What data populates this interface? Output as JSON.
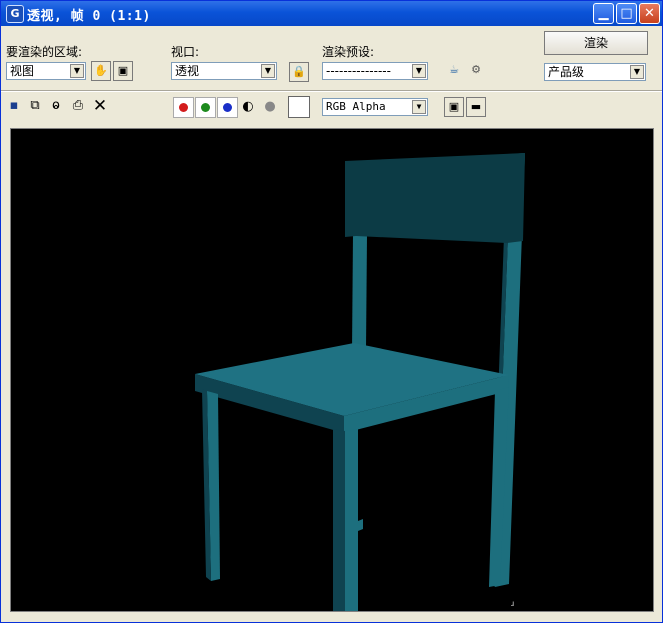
{
  "window": {
    "title": "透视, 帧 0 (1:1)",
    "app_icon": "G"
  },
  "controls": {
    "area_label": "要渲染的区域:",
    "area_value": "视图",
    "viewport_label": "视口:",
    "viewport_value": "透视",
    "preset_label": "渲染预设:",
    "preset_value": "---------------",
    "render_button": "渲染",
    "quality_value": "产品级"
  },
  "toolbar": {
    "channel_value": "RGB Alpha"
  },
  "colors": {
    "chair_front": "#1d6f7e",
    "chair_side": "#0f4350",
    "chair_back": "#0c3b45",
    "seat_top": "#1f7283"
  }
}
